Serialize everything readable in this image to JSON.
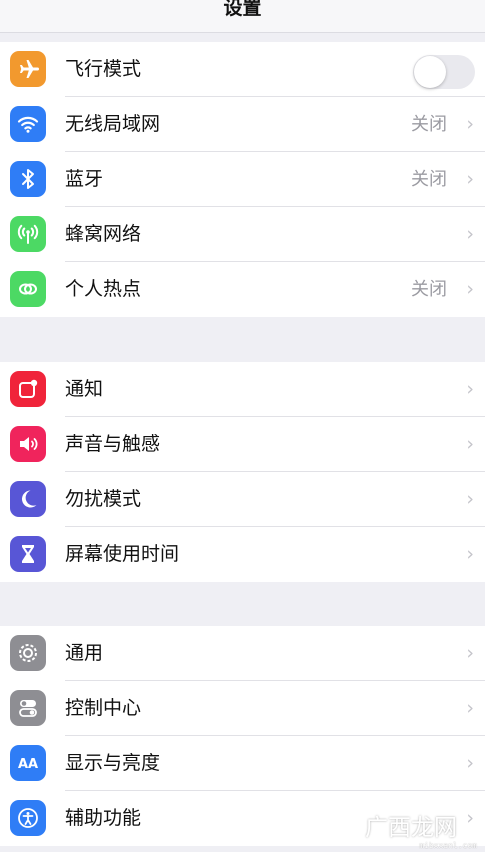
{
  "header": {
    "title": "设置"
  },
  "group1": {
    "airplane": {
      "label": "飞行模式",
      "toggle_on": false
    },
    "wifi": {
      "label": "无线局域网",
      "value": "关闭"
    },
    "bluetooth": {
      "label": "蓝牙",
      "value": "关闭"
    },
    "cellular": {
      "label": "蜂窝网络"
    },
    "hotspot": {
      "label": "个人热点",
      "value": "关闭"
    }
  },
  "group2": {
    "notifications": {
      "label": "通知"
    },
    "sounds": {
      "label": "声音与触感"
    },
    "dnd": {
      "label": "勿扰模式"
    },
    "screentime": {
      "label": "屏幕使用时间"
    }
  },
  "group3": {
    "general": {
      "label": "通用"
    },
    "control": {
      "label": "控制中心"
    },
    "display": {
      "label": "显示与亮度"
    },
    "accessibility": {
      "label": "辅助功能"
    }
  },
  "chevron": "›",
  "watermark": {
    "text": "广西龙网",
    "url": "mibxxanl.com"
  },
  "colors": {
    "airplane": "#f2992e",
    "wifi": "#2f7df6",
    "bluetooth": "#2f7df6",
    "cellular": "#4cd964",
    "hotspot": "#4cd964",
    "notifications": "#f0243a",
    "sounds": "#f0245c",
    "dnd": "#5856d6",
    "screentime": "#5856d6",
    "general": "#8e8e93",
    "control": "#8e8e93",
    "display": "#2f7df6",
    "accessibility": "#2f7df6"
  }
}
